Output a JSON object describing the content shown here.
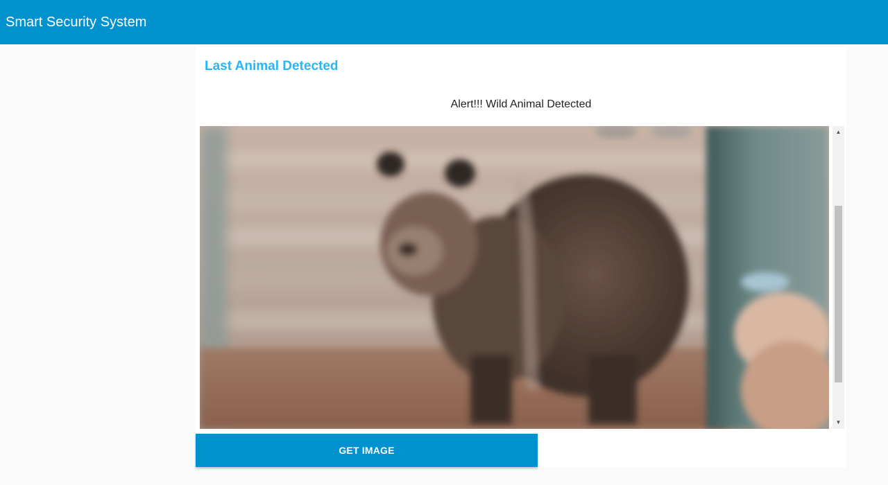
{
  "app": {
    "title": "Smart Security System",
    "bar_color": "#0092cf"
  },
  "card": {
    "heading": "Last Animal Detected",
    "alert_message": "Alert!!! Wild Animal Detected",
    "image": {
      "subject": "brown-bear-photo"
    }
  },
  "actions": {
    "get_image_label": "GET IMAGE"
  },
  "colors": {
    "accent": "#29b6f6",
    "primary": "#0092cf",
    "background": "#fafafa"
  }
}
